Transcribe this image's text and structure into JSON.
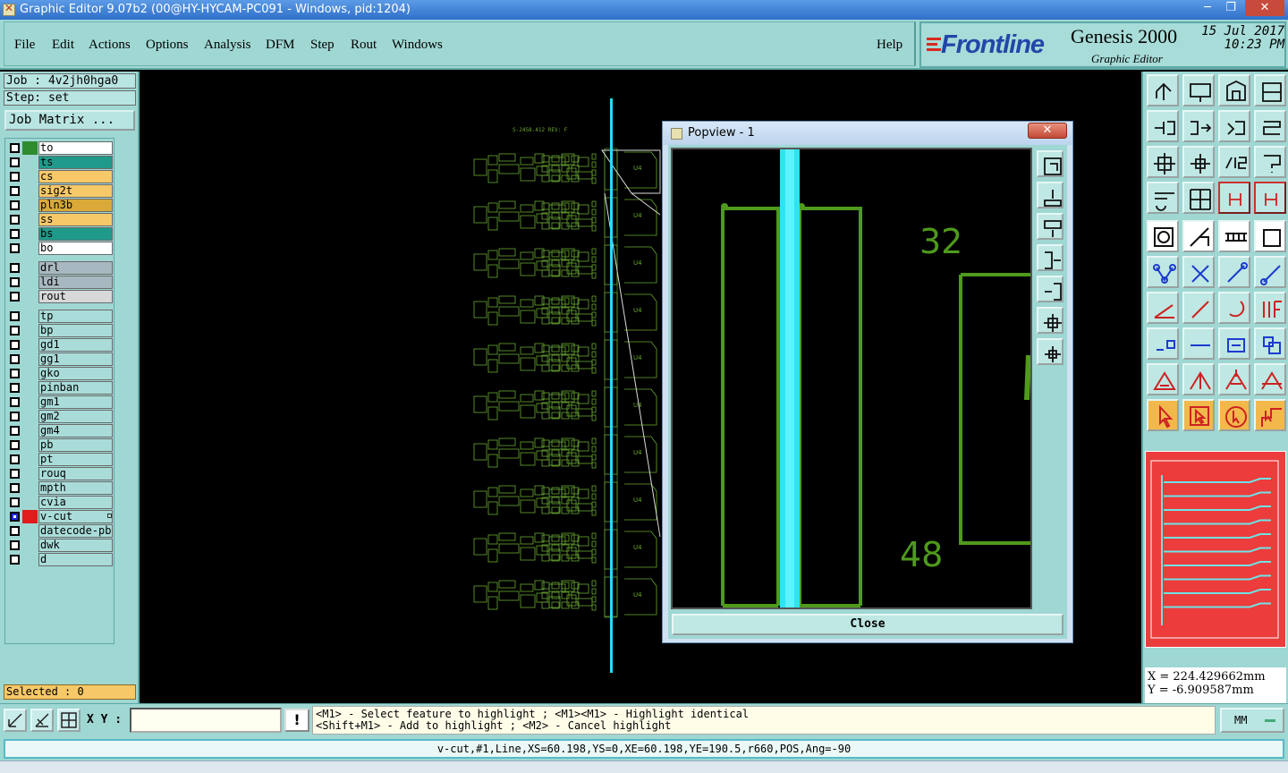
{
  "window": {
    "title": "Graphic Editor 9.07b2 (00@HY-HYCAM-PC091 - Windows, pid:1204)",
    "minimize": "─",
    "restore": "❐",
    "close": "✕"
  },
  "menu": {
    "items": [
      "File",
      "Edit",
      "Actions",
      "Options",
      "Analysis",
      "DFM",
      "Step",
      "Rout",
      "Windows"
    ],
    "help": "Help"
  },
  "brand": {
    "logo": "Frontline",
    "product": "Genesis 2000",
    "subtitle": "Graphic Editor",
    "date": "15 Jul 2017",
    "time": "10:23 PM"
  },
  "job": {
    "job_label": "Job : 4v2jh0hga0",
    "step_label": "Step: set",
    "matrix_button": "Job Matrix ..."
  },
  "layers": [
    {
      "name": "to",
      "color": "#ffffff",
      "swatch": "#2e8b2e"
    },
    {
      "name": "ts",
      "color": "#1f9a8a",
      "swatch": ""
    },
    {
      "name": "cs",
      "color": "#f6c868",
      "swatch": ""
    },
    {
      "name": "sig2t",
      "color": "#f6c868",
      "swatch": ""
    },
    {
      "name": "pln3b",
      "color": "#d9a93a",
      "swatch": ""
    },
    {
      "name": "ss",
      "color": "#f6c868",
      "swatch": ""
    },
    {
      "name": "bs",
      "color": "#1f9a8a",
      "swatch": ""
    },
    {
      "name": "bo",
      "color": "#ffffff",
      "swatch": ""
    },
    {
      "name": "drl",
      "color": "#a8b8c0",
      "swatch": ""
    },
    {
      "name": "ldi",
      "color": "#a8b8c0",
      "swatch": ""
    },
    {
      "name": "rout",
      "color": "#d8d8d8",
      "swatch": ""
    },
    {
      "name": "tp",
      "color": "#a9dcd9",
      "swatch": ""
    },
    {
      "name": "bp",
      "color": "#a9dcd9",
      "swatch": ""
    },
    {
      "name": "gd1",
      "color": "#a9dcd9",
      "swatch": ""
    },
    {
      "name": "gg1",
      "color": "#a9dcd9",
      "swatch": ""
    },
    {
      "name": "gko",
      "color": "#a9dcd9",
      "swatch": ""
    },
    {
      "name": "pinban",
      "color": "#a9dcd9",
      "swatch": ""
    },
    {
      "name": "gm1",
      "color": "#a9dcd9",
      "swatch": ""
    },
    {
      "name": "gm2",
      "color": "#a9dcd9",
      "swatch": ""
    },
    {
      "name": "gm4",
      "color": "#a9dcd9",
      "swatch": ""
    },
    {
      "name": "pb",
      "color": "#a9dcd9",
      "swatch": ""
    },
    {
      "name": "pt",
      "color": "#a9dcd9",
      "swatch": ""
    },
    {
      "name": "rouq",
      "color": "#a9dcd9",
      "swatch": ""
    },
    {
      "name": "mpth",
      "color": "#a9dcd9",
      "swatch": ""
    },
    {
      "name": "cvia",
      "color": "#a9dcd9",
      "swatch": ""
    },
    {
      "name": "v-cut",
      "color": "#a9dcd9",
      "swatch": "#e21b1b",
      "active": true
    },
    {
      "name": "datecode-pbc",
      "color": "#a9dcd9",
      "swatch": ""
    },
    {
      "name": "dwk",
      "color": "#a9dcd9",
      "swatch": ""
    },
    {
      "name": "d",
      "color": "#a9dcd9",
      "swatch": ""
    }
  ],
  "selected": "Selected : 0",
  "canvas": {
    "header_text": "S-2458.412 REV: F",
    "part_label": "U4",
    "feature_color": "#6aa832",
    "vcut_color": "#22dff0"
  },
  "popview": {
    "title": "Popview - 1",
    "close_x": "✕",
    "close_button": "Close",
    "labels": [
      "32",
      "48"
    ]
  },
  "coords": {
    "x": "X = 224.429662mm",
    "y": "Y = -6.909587mm"
  },
  "bottom": {
    "xy_label": "X Y :",
    "xy_value": "",
    "bang": "!",
    "hint_line1": "<M1> - Select feature to highlight ; <M1><M1> - Highlight identical",
    "hint_line2": "<Shift+M1> - Add to highlight ; <M2> - Cancel highlight",
    "units": "MM"
  },
  "status": "v-cut,#1,Line,XS=60.198,YS=0,XE=60.198,YE=190.5,r660,POS,Ang=-90"
}
